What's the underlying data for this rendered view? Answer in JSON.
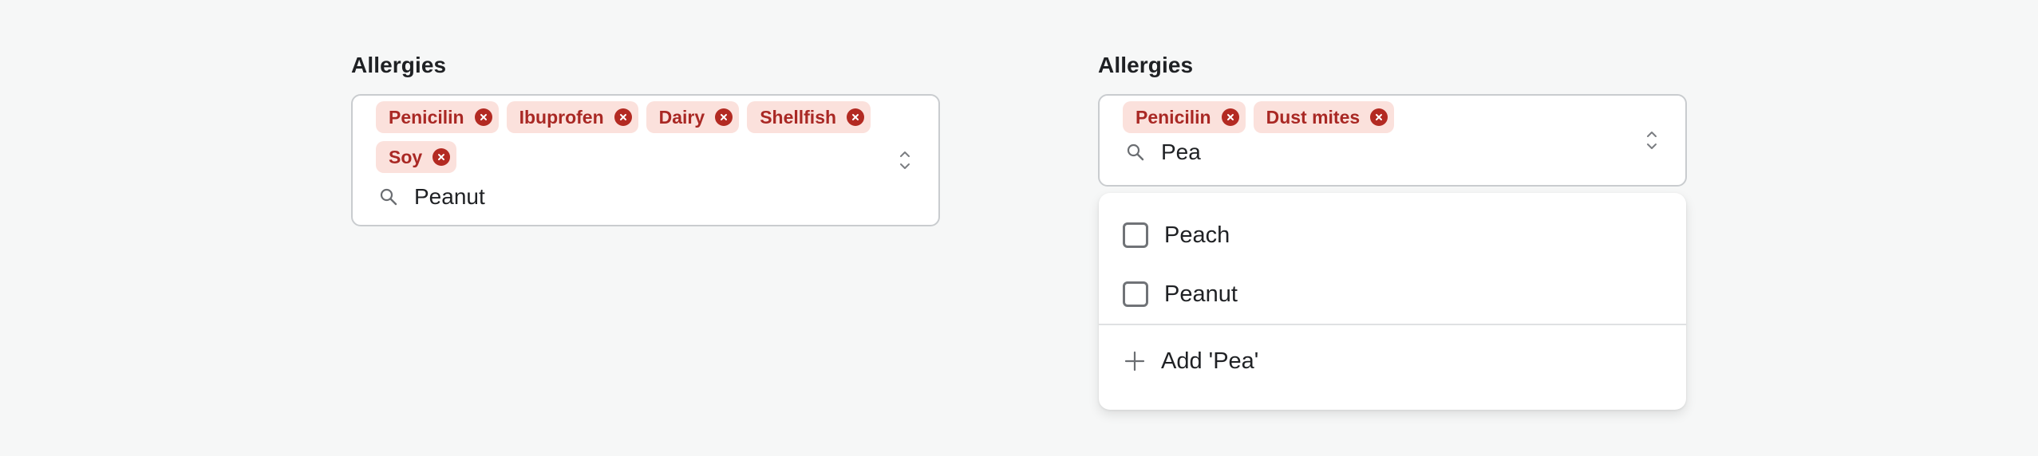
{
  "left_field": {
    "label": "Allergies",
    "chips": [
      "Penicilin",
      "Ibuprofen",
      "Dairy",
      "Shellfish",
      "Soy"
    ],
    "search": {
      "value": "Peanut"
    }
  },
  "right_field": {
    "label": "Allergies",
    "chips": [
      "Penicilin",
      "Dust mites"
    ],
    "search": {
      "value": "Pea"
    },
    "menu": {
      "options": [
        "Peach",
        "Peanut"
      ],
      "add_label": "Add 'Pea'"
    }
  },
  "colors": {
    "chip_bg": "#fbe1dc",
    "chip_text": "#a92824",
    "chip_remove": "#b32a22",
    "page_bg": "#f6f7f7"
  },
  "icons": [
    "close-circle-icon",
    "search-icon",
    "chevron-up-down-icon",
    "plus-icon",
    "checkbox"
  ]
}
